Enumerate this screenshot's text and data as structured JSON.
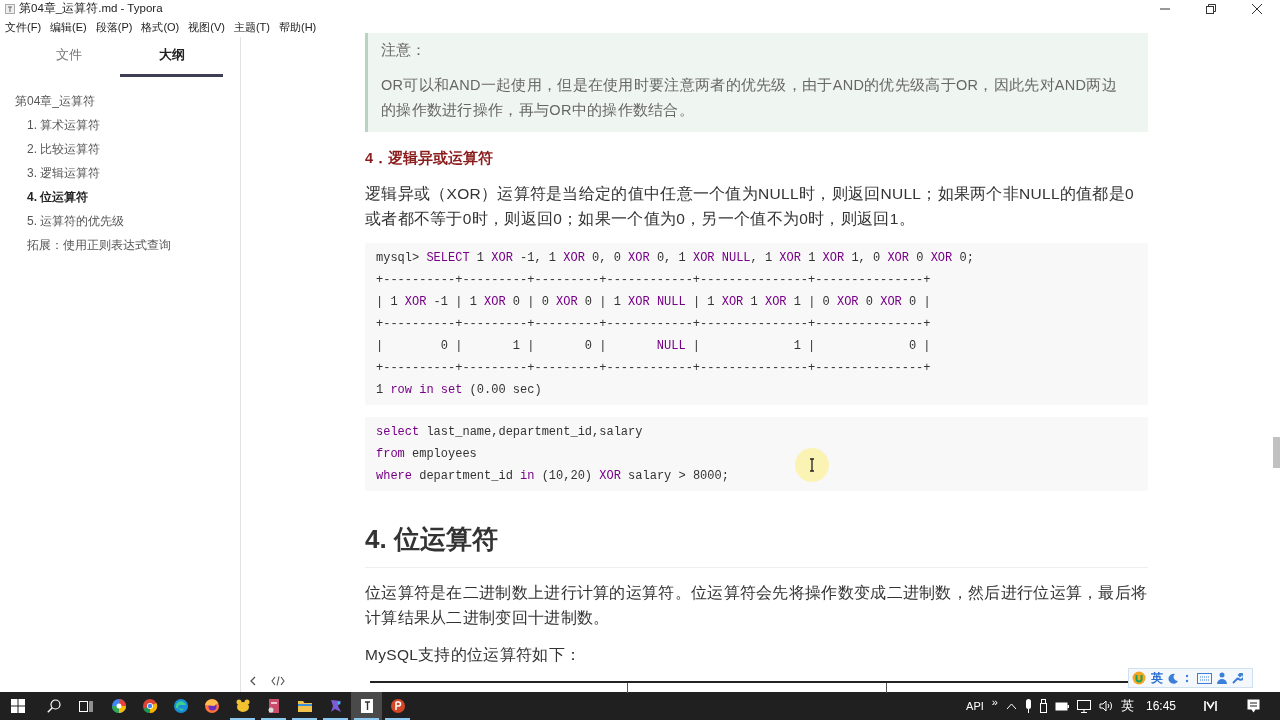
{
  "window": {
    "title": "第04章_运算符.md - Typora"
  },
  "menu": [
    "文件(F)",
    "编辑(E)",
    "段落(P)",
    "格式(O)",
    "视图(V)",
    "主题(T)",
    "帮助(H)"
  ],
  "sidebar": {
    "tabs": [
      {
        "label": "文件",
        "selected": false
      },
      {
        "label": "大纲",
        "selected": true
      }
    ],
    "outline": [
      {
        "label": "第04章_运算符",
        "selected": false,
        "children": [
          {
            "label": "1. 算术运算符",
            "selected": false
          },
          {
            "label": "2. 比较运算符",
            "selected": false
          },
          {
            "label": "3. 逻辑运算符",
            "selected": false
          },
          {
            "label": "4. 位运算符",
            "selected": true
          },
          {
            "label": "5. 运算符的优先级",
            "selected": false
          },
          {
            "label": "拓展：使用正则表达式查询",
            "selected": false
          }
        ]
      }
    ]
  },
  "content": [
    {
      "kind": "note",
      "title": "注意：",
      "text": "OR可以和AND一起使用，但是在使用时要注意两者的优先级，由于AND的优先级高于OR，因此先对AND两边的操作数进行操作，再与OR中的操作数结合。"
    },
    {
      "kind": "h4",
      "text": "4．逻辑异或运算符"
    },
    {
      "kind": "paragraph",
      "text": "逻辑异或（XOR）运算符是当给定的值中任意一个值为NULL时，则返回NULL；如果两个非NULL的值都是0或者都不等于0时，则返回0；如果一个值为0，另一个值不为0时，则返回1。"
    },
    {
      "kind": "code",
      "lines": [
        [
          {
            "text": "mysql> ",
            "kind": "plain"
          },
          {
            "text": "SELECT",
            "kind": "keyword"
          },
          {
            "text": " 1 ",
            "kind": "plain"
          },
          {
            "text": "XOR",
            "kind": "keyword"
          },
          {
            "text": " -1, 1 ",
            "kind": "plain"
          },
          {
            "text": "XOR",
            "kind": "keyword"
          },
          {
            "text": " 0, 0 ",
            "kind": "plain"
          },
          {
            "text": "XOR",
            "kind": "keyword"
          },
          {
            "text": " 0, 1 ",
            "kind": "plain"
          },
          {
            "text": "XOR NULL",
            "kind": "keyword"
          },
          {
            "text": ", 1 ",
            "kind": "plain"
          },
          {
            "text": "XOR",
            "kind": "keyword"
          },
          {
            "text": " 1 ",
            "kind": "plain"
          },
          {
            "text": "XOR",
            "kind": "keyword"
          },
          {
            "text": " 1, 0 ",
            "kind": "plain"
          },
          {
            "text": "XOR",
            "kind": "keyword"
          },
          {
            "text": " 0 ",
            "kind": "plain"
          },
          {
            "text": "XOR",
            "kind": "keyword"
          },
          {
            "text": " 0;",
            "kind": "plain"
          }
        ],
        [
          {
            "text": "+----------+---------+---------+------------+---------------+---------------+",
            "kind": "plain"
          }
        ],
        [
          {
            "text": "| 1 ",
            "kind": "plain"
          },
          {
            "text": "XOR",
            "kind": "keyword"
          },
          {
            "text": " -1 | 1 ",
            "kind": "plain"
          },
          {
            "text": "XOR",
            "kind": "keyword"
          },
          {
            "text": " 0 | 0 ",
            "kind": "plain"
          },
          {
            "text": "XOR",
            "kind": "keyword"
          },
          {
            "text": " 0 | 1 ",
            "kind": "plain"
          },
          {
            "text": "XOR NULL",
            "kind": "keyword"
          },
          {
            "text": " | 1 ",
            "kind": "plain"
          },
          {
            "text": "XOR",
            "kind": "keyword"
          },
          {
            "text": " 1 ",
            "kind": "plain"
          },
          {
            "text": "XOR",
            "kind": "keyword"
          },
          {
            "text": " 1 | 0 ",
            "kind": "plain"
          },
          {
            "text": "XOR",
            "kind": "keyword"
          },
          {
            "text": " 0 ",
            "kind": "plain"
          },
          {
            "text": "XOR",
            "kind": "keyword"
          },
          {
            "text": " 0 |",
            "kind": "plain"
          }
        ],
        [
          {
            "text": "+----------+---------+---------+------------+---------------+---------------+",
            "kind": "plain"
          }
        ],
        [
          {
            "text": "|        0 |       1 |       0 |       ",
            "kind": "plain"
          },
          {
            "text": "NULL",
            "kind": "keyword"
          },
          {
            "text": " |             1 |             0 |",
            "kind": "plain"
          }
        ],
        [
          {
            "text": "+----------+---------+---------+------------+---------------+---------------+",
            "kind": "plain"
          }
        ],
        [
          {
            "text": "1 ",
            "kind": "plain"
          },
          {
            "text": "row in set",
            "kind": "keyword"
          },
          {
            "text": " (0.00 sec)",
            "kind": "plain"
          }
        ]
      ]
    },
    {
      "kind": "code",
      "lines": [
        [
          {
            "text": "select",
            "kind": "keyword"
          },
          {
            "text": " last_name,department_id,salary",
            "kind": "plain"
          }
        ],
        [
          {
            "text": "from",
            "kind": "keyword"
          },
          {
            "text": " employees",
            "kind": "plain"
          }
        ],
        [
          {
            "text": "where",
            "kind": "keyword"
          },
          {
            "text": " department_id ",
            "kind": "plain"
          },
          {
            "text": "in",
            "kind": "keyword"
          },
          {
            "text": " (10,20) ",
            "kind": "plain"
          },
          {
            "text": "XOR",
            "kind": "keyword"
          },
          {
            "text": " salary > 8000;",
            "kind": "plain"
          }
        ]
      ]
    },
    {
      "kind": "h2",
      "text": "4. 位运算符"
    },
    {
      "kind": "paragraph",
      "text": "位运算符是在二进制数上进行计算的运算符。位运算符会先将操作数变成二进制数，然后进行位运算，最后将计算结果从二进制变回十进制数。"
    },
    {
      "kind": "paragraph",
      "text": "MySQL支持的位运算符如下："
    },
    {
      "kind": "table_top"
    }
  ],
  "ime_toolbar": {
    "label": "英"
  },
  "taskbar": {
    "apps": [
      {
        "kind": "pinwheel",
        "running": false,
        "selected": false
      },
      {
        "kind": "chrome",
        "running": false,
        "selected": false
      },
      {
        "kind": "edge",
        "running": false,
        "selected": false
      },
      {
        "kind": "firefox",
        "running": false,
        "selected": false
      },
      {
        "kind": "yellow",
        "running": true,
        "selected": false
      },
      {
        "kind": "red",
        "running": true,
        "selected": false
      },
      {
        "kind": "folder",
        "running": true,
        "selected": false
      },
      {
        "kind": "purple",
        "running": true,
        "selected": false
      },
      {
        "kind": "typora",
        "running": true,
        "selected": true
      },
      {
        "kind": "powerpoint",
        "running": true,
        "selected": false
      }
    ],
    "tray_label": "API",
    "overflow": "»",
    "input_method": "英",
    "time": "16:45"
  }
}
